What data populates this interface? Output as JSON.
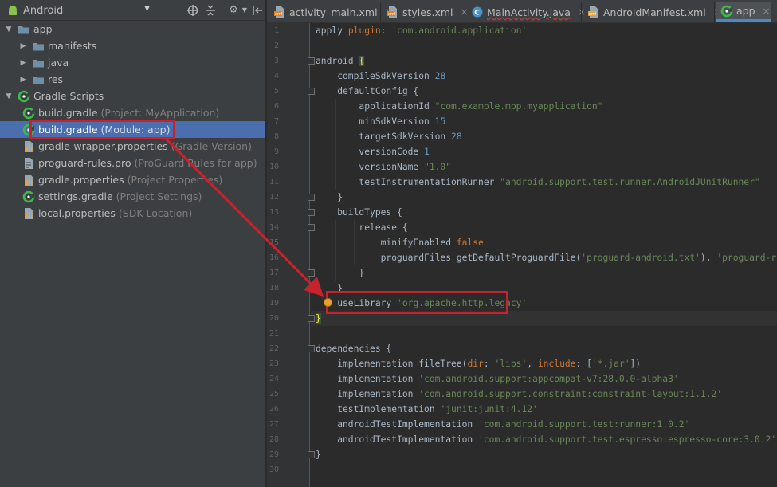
{
  "project_panel": {
    "view_selector": "Android",
    "tree": [
      {
        "name": "app",
        "hint": "",
        "arrow": "expanded",
        "icon": "folder-icon"
      },
      {
        "name": "manifests",
        "hint": "",
        "arrow": "collapsed",
        "icon": "folder-icon"
      },
      {
        "name": "java",
        "hint": "",
        "arrow": "collapsed",
        "icon": "folder-icon"
      },
      {
        "name": "res",
        "hint": "",
        "arrow": "collapsed",
        "icon": "folder-icon"
      },
      {
        "name": "Gradle Scripts",
        "hint": "",
        "arrow": "expanded",
        "icon": "gradle-icon"
      },
      {
        "name": "build.gradle",
        "hint": "(Project: MyApplication)",
        "arrow": "none",
        "icon": "gradle-icon"
      },
      {
        "name": "build.gradle",
        "hint": "(Module: app)",
        "arrow": "none",
        "icon": "gradle-icon",
        "selected": true
      },
      {
        "name": "gradle-wrapper.properties",
        "hint": "(Gradle Version)",
        "arrow": "none",
        "icon": "properties-icon"
      },
      {
        "name": "proguard-rules.pro",
        "hint": "(ProGuard Rules for app)",
        "arrow": "none",
        "icon": "file-icon"
      },
      {
        "name": "gradle.properties",
        "hint": "(Project Properties)",
        "arrow": "none",
        "icon": "properties-icon"
      },
      {
        "name": "settings.gradle",
        "hint": "(Project Settings)",
        "arrow": "none",
        "icon": "gradle-icon"
      },
      {
        "name": "local.properties",
        "hint": "(SDK Location)",
        "arrow": "none",
        "icon": "properties-icon"
      }
    ]
  },
  "tabs": [
    {
      "label": "activity_main.xml",
      "icon": "xml-layout-icon"
    },
    {
      "label": "styles.xml",
      "icon": "xml-values-icon"
    },
    {
      "label": "MainActivity.java",
      "icon": "java-class-icon"
    },
    {
      "label": "AndroidManifest.xml",
      "icon": "manifest-icon"
    },
    {
      "label": "app",
      "icon": "gradle-icon",
      "active": true
    }
  ],
  "editor": {
    "current_line": 20,
    "lines": [
      [
        [
          "plain",
          "apply "
        ],
        [
          "kw",
          "plugin"
        ],
        [
          "plain",
          ": "
        ],
        [
          "str",
          "'com.android.application'"
        ]
      ],
      [],
      [
        [
          "plain",
          "android "
        ],
        [
          "hl",
          "{"
        ]
      ],
      [
        [
          "plain",
          "    compileSdkVersion "
        ],
        [
          "num",
          "28"
        ]
      ],
      [
        [
          "plain",
          "    defaultConfig {"
        ]
      ],
      [
        [
          "plain",
          "        applicationId "
        ],
        [
          "str",
          "\"com.example.mpp.myapplication\""
        ]
      ],
      [
        [
          "plain",
          "        minSdkVersion "
        ],
        [
          "num",
          "15"
        ]
      ],
      [
        [
          "plain",
          "        targetSdkVersion "
        ],
        [
          "num",
          "28"
        ]
      ],
      [
        [
          "plain",
          "        versionCode "
        ],
        [
          "num",
          "1"
        ]
      ],
      [
        [
          "plain",
          "        versionName "
        ],
        [
          "str",
          "\"1.0\""
        ]
      ],
      [
        [
          "plain",
          "        testInstrumentationRunner "
        ],
        [
          "str",
          "\"android.support.test.runner.AndroidJUnitRunner\""
        ]
      ],
      [
        [
          "plain",
          "    }"
        ]
      ],
      [
        [
          "plain",
          "    buildTypes {"
        ]
      ],
      [
        [
          "plain",
          "        release {"
        ]
      ],
      [
        [
          "plain",
          "            minifyEnabled "
        ],
        [
          "kw",
          "false"
        ]
      ],
      [
        [
          "plain",
          "            proguardFiles getDefaultProguardFile("
        ],
        [
          "str",
          "'proguard-android.txt'"
        ],
        [
          "plain",
          "), "
        ],
        [
          "str",
          "'proguard-rules.pro'"
        ]
      ],
      [
        [
          "plain",
          "        }"
        ]
      ],
      [
        [
          "plain",
          "    }"
        ]
      ],
      [
        [
          "plain",
          "    useLibrary "
        ],
        [
          "str",
          "'org.apache.http.legacy'"
        ]
      ],
      [
        [
          "hl",
          "}"
        ]
      ],
      [],
      [
        [
          "plain",
          "dependencies {"
        ]
      ],
      [
        [
          "plain",
          "    implementation fileTree("
        ],
        [
          "kw",
          "dir"
        ],
        [
          "plain",
          ": "
        ],
        [
          "str",
          "'libs'"
        ],
        [
          "plain",
          ", "
        ],
        [
          "kw",
          "include"
        ],
        [
          "plain",
          ": ["
        ],
        [
          "str",
          "'*.jar'"
        ],
        [
          "plain",
          "])"
        ]
      ],
      [
        [
          "plain",
          "    implementation "
        ],
        [
          "str",
          "'com.android.support:appcompat-v7:28.0.0-alpha3'"
        ]
      ],
      [
        [
          "plain",
          "    implementation "
        ],
        [
          "str",
          "'com.android.support.constraint:constraint-layout:1.1.2'"
        ]
      ],
      [
        [
          "plain",
          "    testImplementation "
        ],
        [
          "str",
          "'junit:junit:4.12'"
        ]
      ],
      [
        [
          "plain",
          "    androidTestImplementation "
        ],
        [
          "str",
          "'com.android.support.test:runner:1.0.2'"
        ]
      ],
      [
        [
          "plain",
          "    androidTestImplementation "
        ],
        [
          "str",
          "'com.android.support.test.espresso:espresso-core:3.0.2'"
        ]
      ],
      [
        [
          "plain",
          "}"
        ]
      ],
      []
    ]
  },
  "colors": {
    "annotation": "#c8232c",
    "selection": "#4b6eaf",
    "keyword": "#cc7832",
    "string": "#6a8759",
    "number": "#6897bb"
  }
}
